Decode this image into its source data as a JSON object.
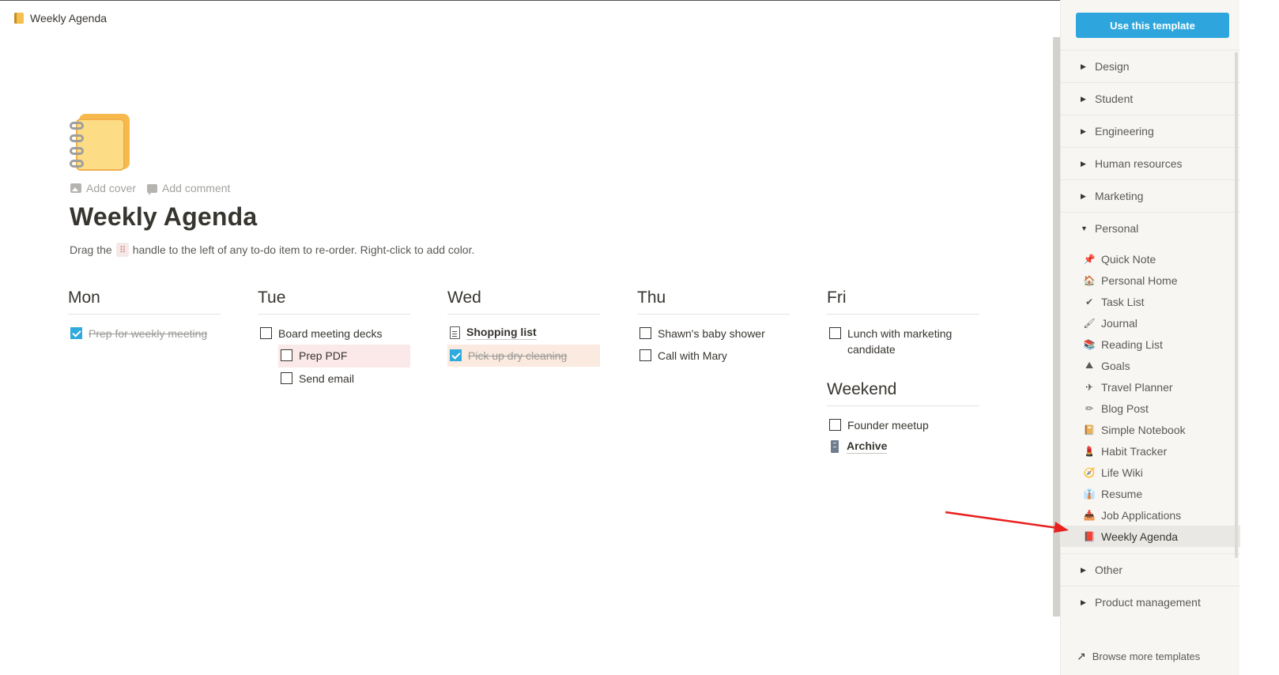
{
  "breadcrumb": {
    "title": "Weekly Agenda",
    "icon": "notebook-icon"
  },
  "page": {
    "icon": "notebook-icon",
    "add_cover": "Add cover",
    "add_comment": "Add comment",
    "title": "Weekly Agenda",
    "desc_before": "Drag the",
    "desc_handle": "⠿",
    "desc_after": "handle to the left of any to-do item to re-order. Right-click to add color."
  },
  "columns": {
    "mon": {
      "heading": "Mon",
      "items": [
        {
          "text": "Prep for weekly meeting",
          "checked": true
        }
      ]
    },
    "tue": {
      "heading": "Tue",
      "items": [
        {
          "text": "Board meeting decks",
          "checked": false
        },
        {
          "text": "Prep PDF",
          "checked": false,
          "color": "red"
        },
        {
          "text": "Send email",
          "checked": false
        }
      ]
    },
    "wed": {
      "heading": "Wed",
      "items": [
        {
          "text": "Shopping list",
          "type": "page"
        },
        {
          "text": "Pick up dry cleaning",
          "checked": true,
          "color": "orange"
        }
      ]
    },
    "thu": {
      "heading": "Thu",
      "items": [
        {
          "text": "Shawn's baby shower",
          "checked": false
        },
        {
          "text": "Call with Mary",
          "checked": false
        }
      ]
    },
    "fri": {
      "heading": "Fri",
      "items": [
        {
          "text": "Lunch with marketing candidate",
          "checked": false
        }
      ]
    },
    "weekend": {
      "heading": "Weekend",
      "items": [
        {
          "text": "Founder meetup",
          "checked": false
        },
        {
          "text": "Archive",
          "type": "page"
        }
      ]
    }
  },
  "sidebar": {
    "use_template": "Use this template",
    "categories": {
      "design": "Design",
      "student": "Student",
      "engineering": "Engineering",
      "hr": "Human resources",
      "marketing": "Marketing",
      "personal": "Personal",
      "other": "Other",
      "product": "Product management"
    },
    "personal_templates": [
      {
        "label": "Quick Note",
        "icon": "pushpin-icon",
        "glyph": "📌"
      },
      {
        "label": "Personal Home",
        "icon": "house-icon",
        "glyph": "🏠"
      },
      {
        "label": "Task List",
        "icon": "check-icon",
        "glyph": "✔"
      },
      {
        "label": "Journal",
        "icon": "brush-icon",
        "glyph": "🖌"
      },
      {
        "label": "Reading List",
        "icon": "books-icon",
        "glyph": "📚"
      },
      {
        "label": "Goals",
        "icon": "mountain-icon",
        "glyph": "⛰"
      },
      {
        "label": "Travel Planner",
        "icon": "airplane-icon",
        "glyph": "✈"
      },
      {
        "label": "Blog Post",
        "icon": "pencil-icon",
        "glyph": "✏"
      },
      {
        "label": "Simple Notebook",
        "icon": "notebook-icon",
        "glyph": "📔"
      },
      {
        "label": "Habit Tracker",
        "icon": "lipstick-icon",
        "glyph": "💄"
      },
      {
        "label": "Life Wiki",
        "icon": "compass-icon",
        "glyph": "🧭"
      },
      {
        "label": "Resume",
        "icon": "necktie-icon",
        "glyph": "👔"
      },
      {
        "label": "Job Applications",
        "icon": "inbox-icon",
        "glyph": "📥"
      },
      {
        "label": "Weekly Agenda",
        "icon": "red-book-icon",
        "glyph": "📕"
      }
    ],
    "browse": "Browse more templates"
  },
  "colors": {
    "accent": "#2ea6dd",
    "checkbox_checked": "#2eaadc",
    "red_bg": "#fbe9e9",
    "orange_bg": "#fbeadf",
    "annotation_arrow": "#e8211f"
  }
}
